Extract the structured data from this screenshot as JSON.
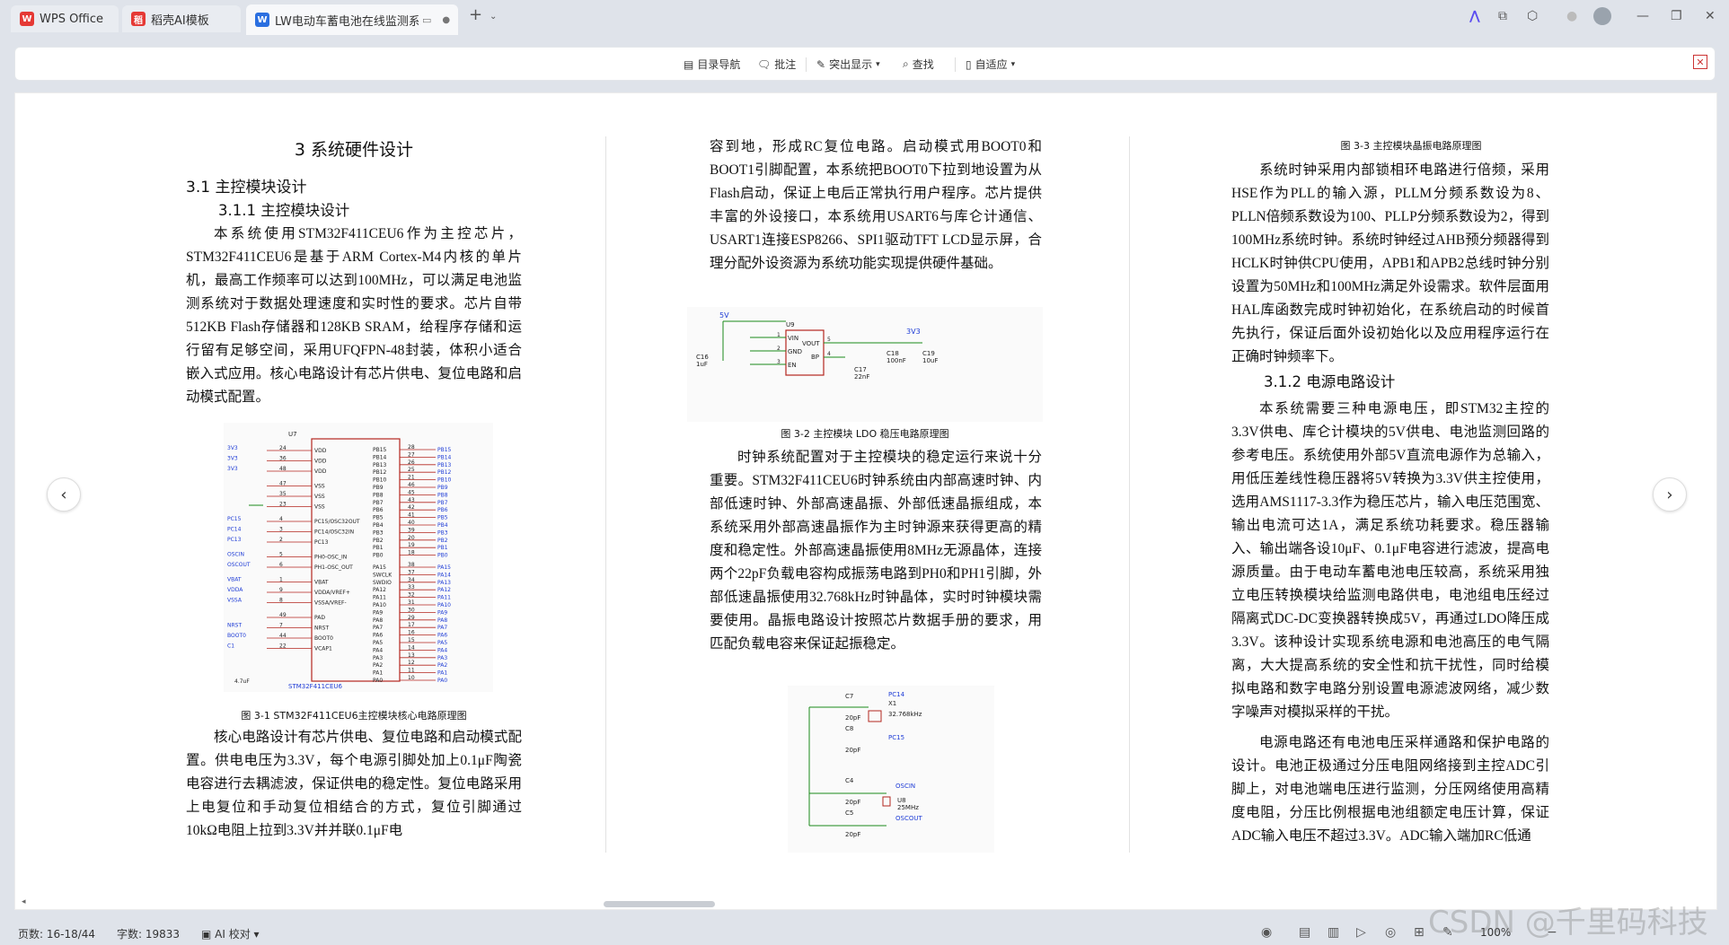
{
  "tabs": [
    {
      "label": "WPS Office",
      "icon": "wps-logo-icon"
    },
    {
      "label": "稻壳AI模板",
      "icon": "docer-icon"
    },
    {
      "label": "LW电动车蓄电池在线监测系",
      "icon": "writer-doc-icon"
    }
  ],
  "toolbar": {
    "toc": "目录导航",
    "comment": "批注",
    "highlight": "突出显示",
    "find": "查找",
    "fit": "自适应"
  },
  "doc": {
    "col1": {
      "h1": "3  系统硬件设计",
      "h2": "3.1   主控模块设计",
      "h3": "3.1.1   主控模块设计",
      "p1": "本系统使用STM32F411CEU6作为主控芯片，STM32F411CEU6是基于ARM Cortex-M4内核的单片机，最高工作频率可以达到100MHz，可以满足电池监测系统对于数据处理速度和实时性的要求。芯片自带512KB Flash存储器和128KB SRAM，给程序存储和运行留有足够空间，采用UFQFPN-48封装，体积小适合嵌入式应用。核心电路设计有芯片供电、复位电路和启动模式配置。",
      "fig_caption": "图 3-1 STM32F411CEU6主控模块核心电路原理图",
      "p2": "核心电路设计有芯片供电、复位电路和启动模式配置。供电电压为3.3V，每个电源引脚处加上0.1μF陶瓷电容进行去耦滤波，保证供电的稳定性。复位电路采用上电复位和手动复位相结合的方式，复位引脚通过10kΩ电阻上拉到3.3V并并联0.1μF电"
    },
    "col2": {
      "p1": "容到地，形成RC复位电路。启动模式用BOOT0和BOOT1引脚配置，本系统把BOOT0下拉到地设置为从Flash启动，保证上电后正常执行用户程序。芯片提供丰富的外设接口，本系统用USART6与库仑计通信、USART1连接ESP8266、SPI1驱动TFT LCD显示屏，合理分配外设资源为系统功能实现提供硬件基础。",
      "fig_caption": "图 3-2 主控模块 LDO 稳压电路原理图",
      "p2": "时钟系统配置对于主控模块的稳定运行来说十分重要。STM32F411CEU6时钟系统由内部高速时钟、内部低速时钟、外部高速晶振、外部低速晶振组成，本系统采用外部高速晶振作为主时钟源来获得更高的精度和稳定性。外部高速晶振使用8MHz无源晶体，连接两个22pF负载电容构成振荡电路到PH0和PH1引脚，外部低速晶振使用32.768kHz时钟晶体，实时时钟模块需要使用。晶振电路设计按照芯片数据手册的要求，用匹配负载电容来保证起振稳定。"
    },
    "col3": {
      "fig_caption": "图 3-3 主控模块晶振电路原理图",
      "p1": "系统时钟采用内部锁相环电路进行倍频，采用HSE作为PLL的输入源，PLLM分频系数设为8、PLLN倍频系数设为100、PLLP分频系数设为2，得到100MHz系统时钟。系统时钟经过AHB预分频器得到HCLK时钟供CPU使用，APB1和APB2总线时钟分别设置为50MHz和100MHz满足外设需求。软件层面用HAL库函数完成时钟初始化，在系统启动的时候首先执行，保证后面外设初始化以及应用程序运行在正确时钟频率下。",
      "h3": "3.1.2  电源电路设计",
      "p2": "本系统需要三种电源电压，即STM32主控的3.3V供电、库仑计模块的5V供电、电池监测回路的参考电压。系统使用外部5V直流电源作为总输入，用低压差线性稳压器将5V转换为3.3V供主控使用，选用AMS1117-3.3作为稳压芯片，输入电压范围宽、输出电流可达1A，满足系统功耗要求。稳压器输入、输出端各设10μF、0.1μF电容进行滤波，提高电源质量。由于电动车蓄电池电压较高，系统采用独立电压转换模块给监测电路供电，电池组电压经过隔离式DC-DC变换器转换成5V，再通过LDO降压成3.3V。该种设计实现系统电源和电池高压的电气隔离，大大提高系统的安全性和抗干扰性，同时给模拟电路和数字电路分别设置电源滤波网络，减少数字噪声对模拟采样的干扰。",
      "p3": "电源电路还有电池电压采样通路和保护电路的设计。电池正极通过分压电阻网络接到主控ADC引脚上，对电池端电压进行监测，分压网络使用高精度电阻，分压比例根据电池组额定电压计算，保证ADC输入电压不超过3.3V。ADC输入端加RC低通"
    }
  },
  "schematic1": {
    "chip": "U7",
    "part": "STM32F411CEU6",
    "left_pins": [
      [
        "3V3",
        "24",
        "VDD"
      ],
      [
        "3V3",
        "36",
        "VDD"
      ],
      [
        "3V3",
        "48",
        "VDD"
      ],
      [
        "",
        "47",
        "VSS"
      ],
      [
        "",
        "35",
        "VSS"
      ],
      [
        "",
        "23",
        "VSS"
      ],
      [
        "PC15",
        "4",
        "PC15/OSC32OUT"
      ],
      [
        "PC14",
        "3",
        "PC14/OSC32IN"
      ],
      [
        "PC13",
        "2",
        "PC13"
      ],
      [
        "OSCIN",
        "5",
        "PH0-OSC_IN"
      ],
      [
        "OSCOUT",
        "6",
        "PH1-OSC_OUT"
      ],
      [
        "VBAT",
        "1",
        "VBAT"
      ],
      [
        "VDDA",
        "9",
        "VDDA/VREF+"
      ],
      [
        "VSSA",
        "8",
        "VSSA/VREF-"
      ],
      [
        "",
        "49",
        "PAD"
      ],
      [
        "NRST",
        "7",
        "NRST"
      ],
      [
        "BOOT0",
        "44",
        "BOOT0"
      ],
      [
        "C1",
        "22",
        "VCAP1"
      ]
    ],
    "right_pins": [
      [
        "PB15",
        "28",
        "PB15"
      ],
      [
        "PB14",
        "27",
        "PB14"
      ],
      [
        "PB13",
        "26",
        "PB13"
      ],
      [
        "PB12",
        "25",
        "PB12"
      ],
      [
        "PB10",
        "21",
        "PB10"
      ],
      [
        "PB9",
        "46",
        "PB9"
      ],
      [
        "PB8",
        "45",
        "PB8"
      ],
      [
        "PB7",
        "43",
        "PB7"
      ],
      [
        "PB6",
        "42",
        "PB6"
      ],
      [
        "PB5",
        "41",
        "PB5"
      ],
      [
        "PB4",
        "40",
        "PB4"
      ],
      [
        "PB3",
        "39",
        "PB3"
      ],
      [
        "PB2",
        "20",
        "PB2"
      ],
      [
        "PB1",
        "19",
        "PB1"
      ],
      [
        "PB0",
        "18",
        "PB0"
      ],
      [
        "PA15",
        "38",
        "PA15"
      ],
      [
        "PA14",
        "37",
        "SWCLK"
      ],
      [
        "PA13",
        "34",
        "SWDIO"
      ],
      [
        "PA12",
        "33",
        "PA12"
      ],
      [
        "PA11",
        "32",
        "PA11"
      ],
      [
        "PA10",
        "31",
        "PA10"
      ],
      [
        "PA9",
        "30",
        "PA9"
      ],
      [
        "PA8",
        "29",
        "PA8"
      ],
      [
        "PA7",
        "17",
        "PA7"
      ],
      [
        "PA6",
        "16",
        "PA6"
      ],
      [
        "PA5",
        "15",
        "PA5"
      ],
      [
        "PA4",
        "14",
        "PA4"
      ],
      [
        "PA3",
        "13",
        "PA3"
      ],
      [
        "PA2",
        "12",
        "PA2"
      ],
      [
        "PA1",
        "11",
        "PA1"
      ],
      [
        "PA0",
        "10",
        "PA0"
      ]
    ],
    "cap": "4.7uF"
  },
  "schematic2": {
    "in": "5V",
    "out": "3V3",
    "chip": "U9",
    "pins": [
      "VIN",
      "GND",
      "EN",
      "VOUT",
      "BP"
    ],
    "pin_nums": [
      "1",
      "2",
      "3",
      "5",
      "4"
    ],
    "caps": [
      "C16",
      "1uF",
      "C17",
      "22nF",
      "C18",
      "100nF",
      "C19",
      "10uF"
    ]
  },
  "schematic3": {
    "caps": [
      "C7",
      "20pF",
      "C8",
      "20pF",
      "C4",
      "20pF",
      "C5",
      "20pF"
    ],
    "x1": "X1",
    "x1_freq": "32.768kHz",
    "u8": "U8",
    "u8_freq": "25MHz",
    "nets": [
      "PC14",
      "PC15",
      "OSCIN",
      "OSCOUT"
    ]
  },
  "status": {
    "page": "页数: 16-18/44",
    "words": "字数: 19833",
    "ai": "AI 校对",
    "zoom": "100%"
  },
  "watermark": "CSDN @千里码科技"
}
